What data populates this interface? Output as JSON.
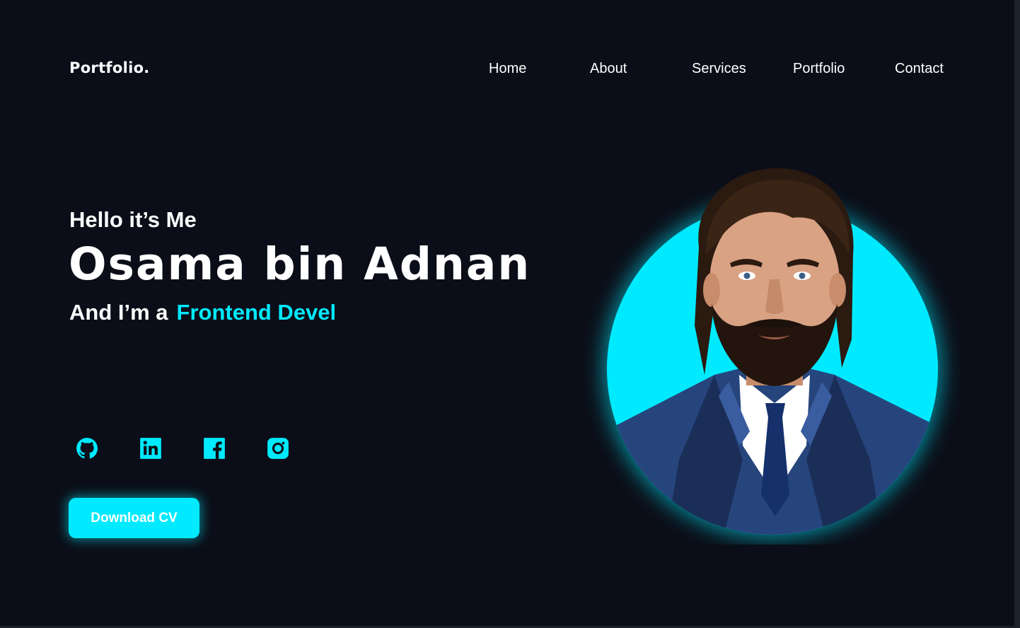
{
  "header": {
    "logo": "Portfolio.",
    "nav": [
      {
        "label": "Home"
      },
      {
        "label": "About"
      },
      {
        "label": "Services"
      },
      {
        "label": "Portfolio"
      },
      {
        "label": "Contact"
      }
    ]
  },
  "hero": {
    "greeting": "Hello it’s Me",
    "name": "Osama bin Adnan",
    "role_prefix": "And I’m a",
    "role": "Frontend Devel",
    "cta_label": "Download CV"
  },
  "socials": [
    {
      "icon": "github-icon"
    },
    {
      "icon": "linkedin-icon"
    },
    {
      "icon": "facebook-icon"
    },
    {
      "icon": "instagram-icon"
    }
  ],
  "colors": {
    "background": "#0b0e18",
    "accent": "#00eaff",
    "text": "#ffffff"
  }
}
